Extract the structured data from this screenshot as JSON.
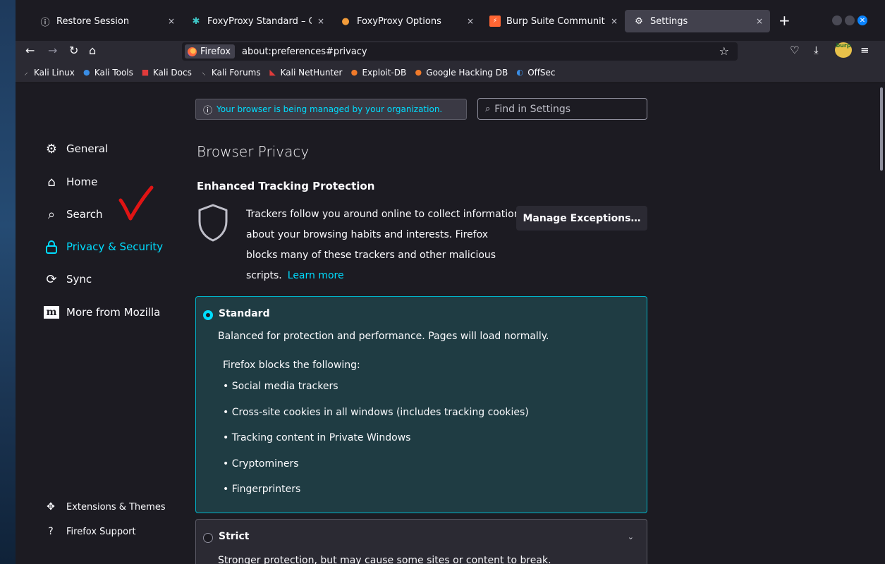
{
  "tabs": [
    {
      "label": "Restore Session",
      "icon": "info-icon",
      "close": "×"
    },
    {
      "label": "FoxyProxy Standard – Ge",
      "icon": "foxyproxy-icon",
      "close": "×"
    },
    {
      "label": "FoxyProxy Options",
      "icon": "foxyproxy-icon",
      "close": "×"
    },
    {
      "label": "Burp Suite Community E",
      "icon": "burp-icon",
      "close": "×"
    },
    {
      "label": "Settings",
      "icon": "gear-icon",
      "close": "×"
    }
  ],
  "newtab": "+",
  "urlbar": {
    "identity": "Firefox",
    "url": "about:preferences#privacy"
  },
  "bookmarks": [
    "Kali Linux",
    "Kali Tools",
    "Kali Docs",
    "Kali Forums",
    "Kali NetHunter",
    "Exploit-DB",
    "Google Hacking DB",
    "OffSec"
  ],
  "notice": {
    "managed": "Your browser is being managed by your organization.",
    "find_placeholder": "Find in Settings"
  },
  "sidebar": {
    "items": [
      {
        "label": "General",
        "icon": "gear-icon"
      },
      {
        "label": "Home",
        "icon": "home-icon"
      },
      {
        "label": "Search",
        "icon": "search-icon"
      },
      {
        "label": "Privacy & Security",
        "icon": "lock-icon",
        "active": true
      },
      {
        "label": "Sync",
        "icon": "sync-icon"
      },
      {
        "label": "More from Mozilla",
        "icon": "mozilla-icon"
      }
    ],
    "footer": [
      {
        "label": "Extensions & Themes",
        "icon": "puzzle-icon"
      },
      {
        "label": "Firefox Support",
        "icon": "help-icon"
      }
    ]
  },
  "main": {
    "title": "Browser Privacy",
    "etp_title": "Enhanced Tracking Protection",
    "etp_desc": "Trackers follow you around online to collect information about your browsing habits and interests. Firefox blocks many of these trackers and other malicious scripts.",
    "learn_more": "Learn more",
    "manage_button": "Manage Exceptions…",
    "standard": {
      "label": "Standard",
      "desc": "Balanced for protection and performance. Pages will load normally.",
      "blocks_head": "Firefox blocks the following:",
      "blocks": [
        "Social media trackers",
        "Cross-site cookies in all windows (includes tracking cookies)",
        "Tracking content in Private Windows",
        "Cryptominers",
        "Fingerprinters"
      ]
    },
    "strict": {
      "label": "Strict",
      "desc": "Stronger protection, but may cause some sites or content to break."
    }
  },
  "colors": {
    "accent": "#00ddff",
    "background": "#1c1b22",
    "standard_box": "#1f3c43",
    "annotation": "#e01414"
  }
}
